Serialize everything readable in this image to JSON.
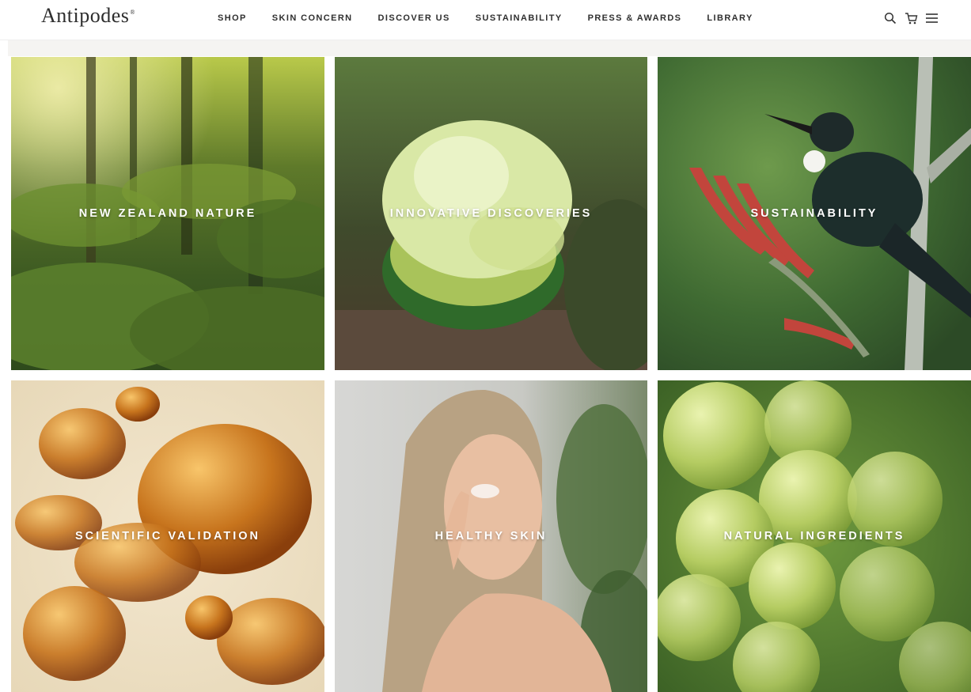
{
  "brand": {
    "logo_text": "Antipodes"
  },
  "nav": {
    "items": [
      {
        "label": "SHOP"
      },
      {
        "label": "SKIN CONCERN"
      },
      {
        "label": "DISCOVER US"
      },
      {
        "label": "SUSTAINABILITY"
      },
      {
        "label": "PRESS & AWARDS"
      },
      {
        "label": "LIBRARY"
      }
    ]
  },
  "header_icons": [
    "search-icon",
    "cart-icon",
    "menu-icon"
  ],
  "tiles": [
    {
      "label": "NEW ZEALAND NATURE",
      "image": "forest-ferns"
    },
    {
      "label": "INNOVATIVE DISCOVERIES",
      "image": "finger-lime"
    },
    {
      "label": "SUSTAINABILITY",
      "image": "tui-bird-flax-flower"
    },
    {
      "label": "SCIENTIFIC VALIDATION",
      "image": "amber-oil-droplets"
    },
    {
      "label": "HEALTHY SKIN",
      "image": "woman-applying-cream"
    },
    {
      "label": "NATURAL INGREDIENTS",
      "image": "green-grapes"
    }
  ],
  "colors": {
    "text": "#2f2f2f",
    "strip": "#f5f4f2",
    "label": "#ffffff"
  }
}
